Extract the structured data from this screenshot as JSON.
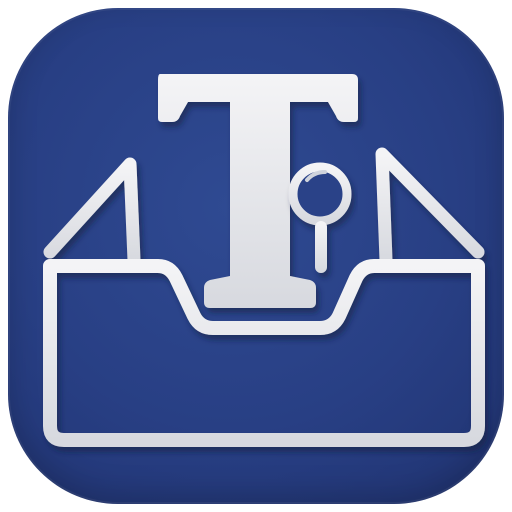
{
  "icon": {
    "name": "text-search-inbox-app-icon",
    "background_color": "#283f84",
    "glyph_color": "#e9eaee",
    "shadow_color": "#16244f",
    "symbols": [
      "letter-t-icon",
      "magnifier-icon",
      "inbox-tray-icon"
    ]
  },
  "glyph_letter": "T"
}
